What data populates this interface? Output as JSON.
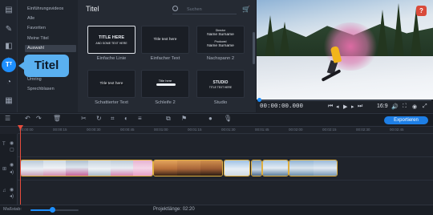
{
  "rail": {
    "icons": [
      "import-icon",
      "tools-icon",
      "transitions-icon",
      "fx-icon",
      "titles-icon",
      "stickers-icon",
      "more-icon"
    ],
    "active_label": "Tᵀ"
  },
  "callout": {
    "text": "Titel"
  },
  "categories": [
    {
      "label": "Einführungsvideos"
    },
    {
      "label": "Alle"
    },
    {
      "label": "Favoriten"
    },
    {
      "label": "Meine Titel"
    },
    {
      "label": "Auswahl"
    },
    {
      "label": "Umring"
    },
    {
      "label": "Sprechblasen"
    }
  ],
  "panel": {
    "title": "Titel",
    "search_placeholder": "Suchen",
    "items": [
      {
        "label": "Einfache Linie",
        "line1": "TITLE HERE",
        "line2": "AND SOME TEXT HERE"
      },
      {
        "label": "Einfacher Text",
        "line1": "Title text here",
        "line2": ""
      },
      {
        "label": "Nachspann 2",
        "line1": "Director",
        "line2": "Name Surname",
        "line3": "Produced",
        "line4": "Name Surname"
      },
      {
        "label": "Schattierter Text",
        "line1": "Title text here",
        "line2": ""
      },
      {
        "label": "Schleife 2",
        "line1": "Title here",
        "line2": ""
      },
      {
        "label": "Studio",
        "line1": "STUDIO",
        "line2": "TITLE TEXT HERE"
      }
    ]
  },
  "preview": {
    "help_label": "?"
  },
  "player": {
    "time": "00:00:00.000",
    "ratio": "16:9",
    "progress": 0.0
  },
  "toolbar": {
    "export_label": "Exportieren"
  },
  "timeline": {
    "ticks": [
      "00:00:00",
      "00:00:15",
      "00:00:30",
      "00:00:45",
      "00:01:00",
      "00:01:15",
      "00:01:30",
      "00:01:45",
      "00:02:00",
      "00:02:15",
      "00:02:30",
      "00:02:45"
    ]
  },
  "status": {
    "scale_label": "Maßstab:",
    "zoom": 0.45,
    "project_length": "Projektlänge: 02:20"
  }
}
